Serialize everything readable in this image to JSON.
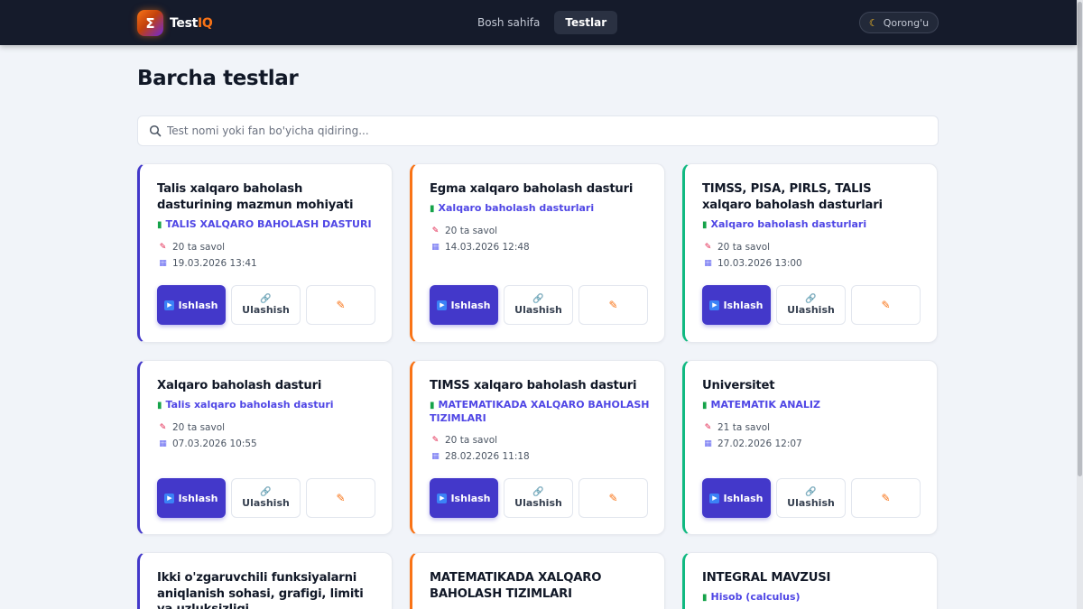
{
  "navbar": {
    "logo_mark": "Σ",
    "logo_text_main": "Test",
    "logo_text_accent": "IQ",
    "links": [
      {
        "label": "Bosh sahifa",
        "active": false
      },
      {
        "label": "Testlar",
        "active": true
      }
    ],
    "theme_icon": "moon-icon",
    "theme_label": "Qorong'u"
  },
  "main": {
    "title": "Barcha testlar",
    "search_placeholder": "Test nomi yoki fan bo'yicha qidiring..."
  },
  "actions": {
    "solve_label": "Ishlash",
    "share_label": "Ulashish"
  },
  "colors": {
    "accent": "#4338ca",
    "orange": "#f97316",
    "green": "#10b981",
    "navbar_bg": "#151b2b",
    "page_bg": "#f1f4f9"
  },
  "tests": [
    {
      "title": "Talis xalqaro baholash dasturining mazmun mohiyati",
      "subject": "TALIS XALQARO BAHOLASH DASTURI",
      "questions": "20 ta savol",
      "date": "19.03.2026 13:41"
    },
    {
      "title": "Egma xalqaro baholash dasturi",
      "subject": "Xalqaro baholash dasturlari",
      "questions": "20 ta savol",
      "date": "14.03.2026 12:48"
    },
    {
      "title": "TIMSS, PISA, PIRLS, TALIS xalqaro baholash dasturlari",
      "subject": "Xalqaro baholash dasturlari",
      "questions": "20 ta savol",
      "date": "10.03.2026 13:00"
    },
    {
      "title": "Xalqaro baholash dasturi",
      "subject": "Talis xalqaro baholash dasturi",
      "questions": "20 ta savol",
      "date": "07.03.2026 10:55"
    },
    {
      "title": "TIMSS xalqaro baholash dasturi",
      "subject": "MATEMATIKADA XALQARO BAHOLASH TIZIMLARI",
      "questions": "20 ta savol",
      "date": "28.02.2026 11:18"
    },
    {
      "title": "Universitet",
      "subject": "MATEMATIK ANALIZ",
      "questions": "21 ta savol",
      "date": "27.02.2026 12:07"
    },
    {
      "title": "Ikki o'zgaruvchili funksiyalarni aniqlanish sohasi, grafigi, limiti va uzluksizligi",
      "subject": "",
      "questions": "",
      "date": ""
    },
    {
      "title": "MATEMATIKADA XALQARO BAHOLASH TIZIMLARI",
      "subject": "",
      "questions": "",
      "date": ""
    },
    {
      "title": "INTEGRAL MAVZUSI",
      "subject": "Hisob (calculus)",
      "questions": "",
      "date": ""
    }
  ]
}
